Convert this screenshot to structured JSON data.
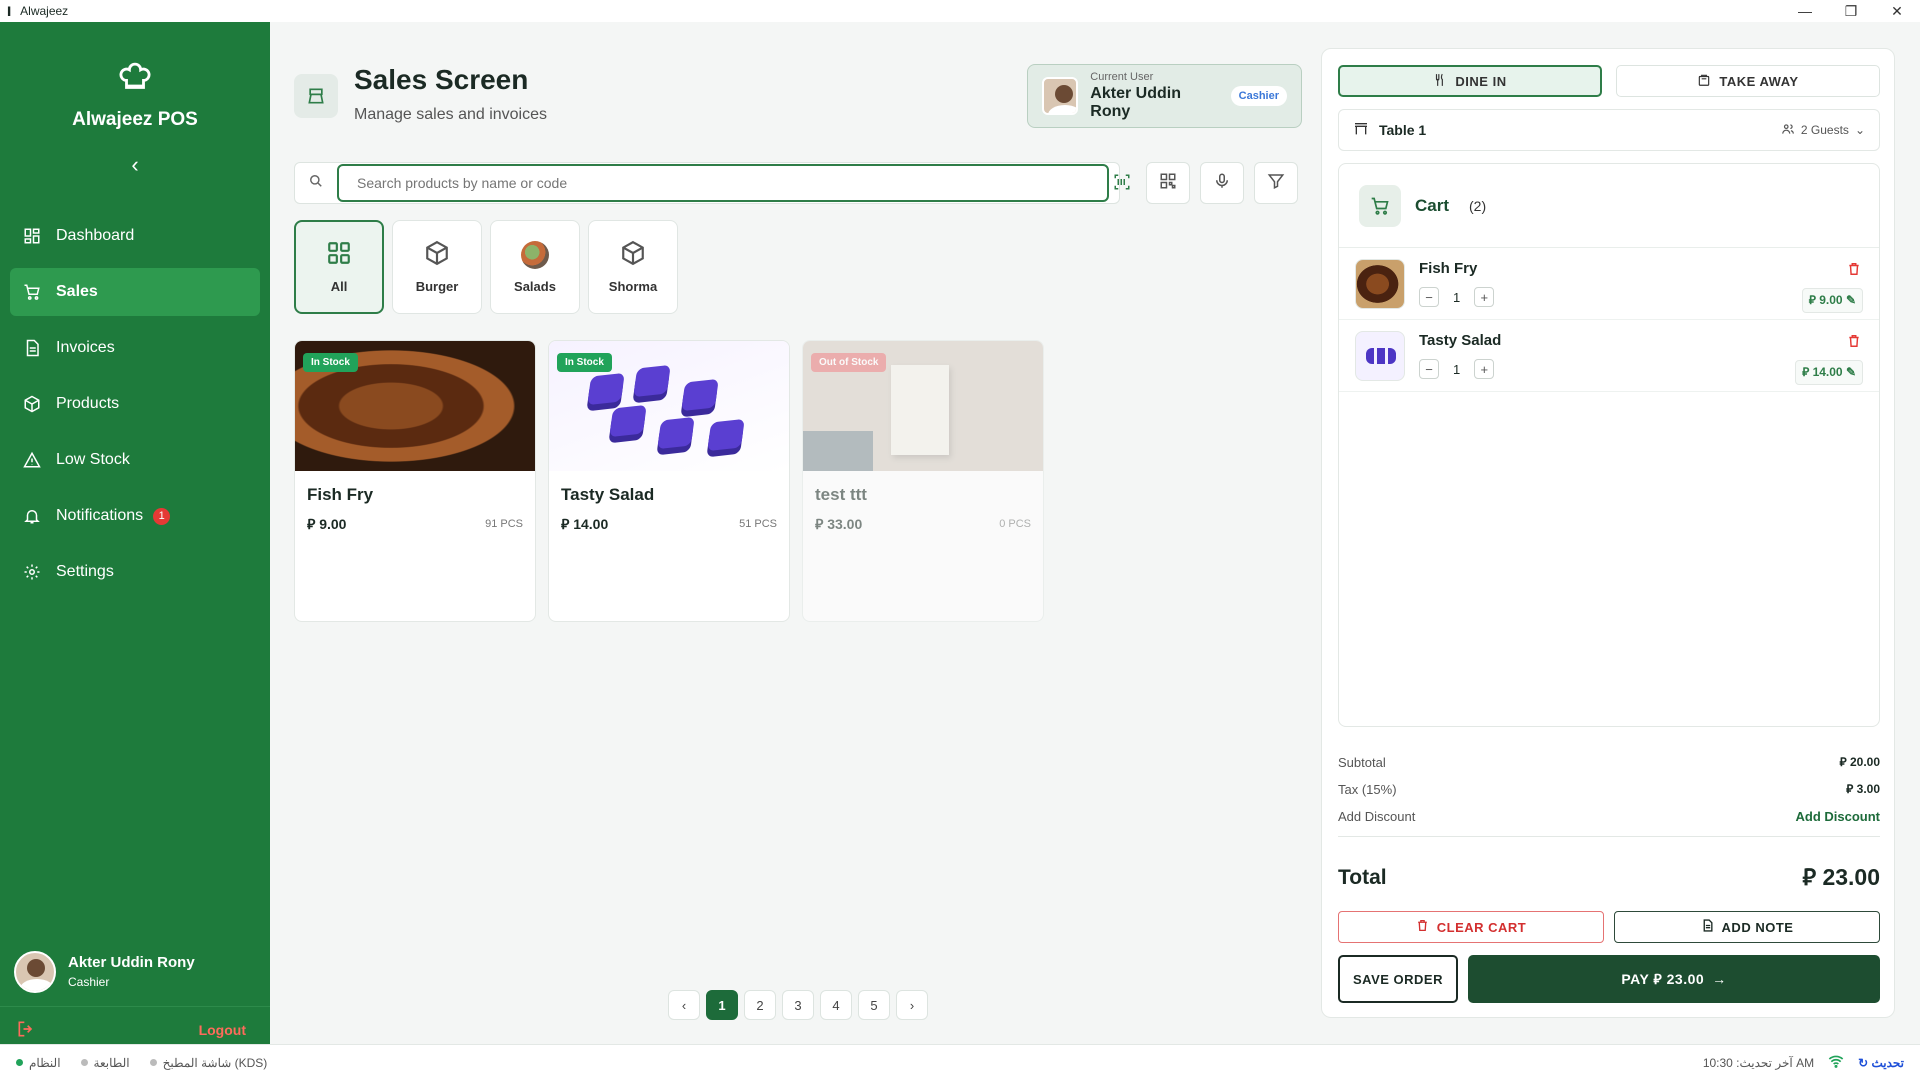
{
  "window": {
    "title": "Alwajeez",
    "controls": [
      "—",
      "❐",
      "✕"
    ]
  },
  "sidebar": {
    "brand": "Alwajeez POS",
    "items": [
      {
        "label": "Dashboard",
        "icon": "dashboard-icon"
      },
      {
        "label": "Sales",
        "icon": "cart-icon",
        "active": true
      },
      {
        "label": "Invoices",
        "icon": "invoice-icon"
      },
      {
        "label": "Products",
        "icon": "box-icon"
      },
      {
        "label": "Low Stock",
        "icon": "warning-icon"
      },
      {
        "label": "Notifications",
        "icon": "bell-icon",
        "badge": "1"
      },
      {
        "label": "Settings",
        "icon": "gear-icon"
      }
    ],
    "user": {
      "name": "Akter Uddin Rony",
      "role": "Cashier"
    },
    "logout": "Logout"
  },
  "header": {
    "title": "Sales Screen",
    "subtitle": "Manage sales and invoices",
    "current_user_label": "Current User",
    "current_user_name": "Akter Uddin Rony",
    "current_user_role": "Cashier"
  },
  "search": {
    "placeholder": "Search products by name or code"
  },
  "categories": [
    {
      "label": "All",
      "active": true
    },
    {
      "label": "Burger"
    },
    {
      "label": "Salads"
    },
    {
      "label": "Shorma"
    }
  ],
  "products": [
    {
      "name": "Fish Fry",
      "price": "9.00",
      "qty": "91 PCS",
      "stock": "In Stock"
    },
    {
      "name": "Tasty Salad",
      "price": "14.00",
      "qty": "51 PCS",
      "stock": "In Stock"
    },
    {
      "name": "test ttt",
      "price": "33.00",
      "qty": "0 PCS",
      "stock": "Out of Stock"
    }
  ],
  "pagination": {
    "pages": [
      "1",
      "2",
      "3",
      "4",
      "5"
    ],
    "current": "1"
  },
  "order": {
    "dine_in": "DINE IN",
    "take_away": "TAKE AWAY",
    "table": "Table 1",
    "guests": "2 Guests",
    "cart_title": "Cart",
    "cart_count": "(2)",
    "items": [
      {
        "name": "Fish Fry",
        "qty": "1",
        "price": "9.00"
      },
      {
        "name": "Tasty Salad",
        "qty": "1",
        "price": "14.00"
      }
    ],
    "subtotal_label": "Subtotal",
    "subtotal": "20.00",
    "tax_label": "Tax (15%)",
    "tax": "3.00",
    "discount_label": "Add Discount",
    "discount_action": "Add Discount",
    "total_label": "Total",
    "total": "23.00",
    "clear_cart": "CLEAR CART",
    "add_note": "ADD NOTE",
    "save_order": "SAVE ORDER",
    "pay": "PAY ⃁ 23.00",
    "currency": "⃁"
  },
  "statusbar": {
    "left": [
      "النظام",
      "الطابعة",
      "شاشة المطبخ (KDS)"
    ],
    "last_update": "آخر تحديث: 10:30 AM",
    "refresh": "تحديث"
  },
  "colors": {
    "primary": "#1e7b3c",
    "dark": "#1d4d30",
    "danger": "#e53935"
  }
}
